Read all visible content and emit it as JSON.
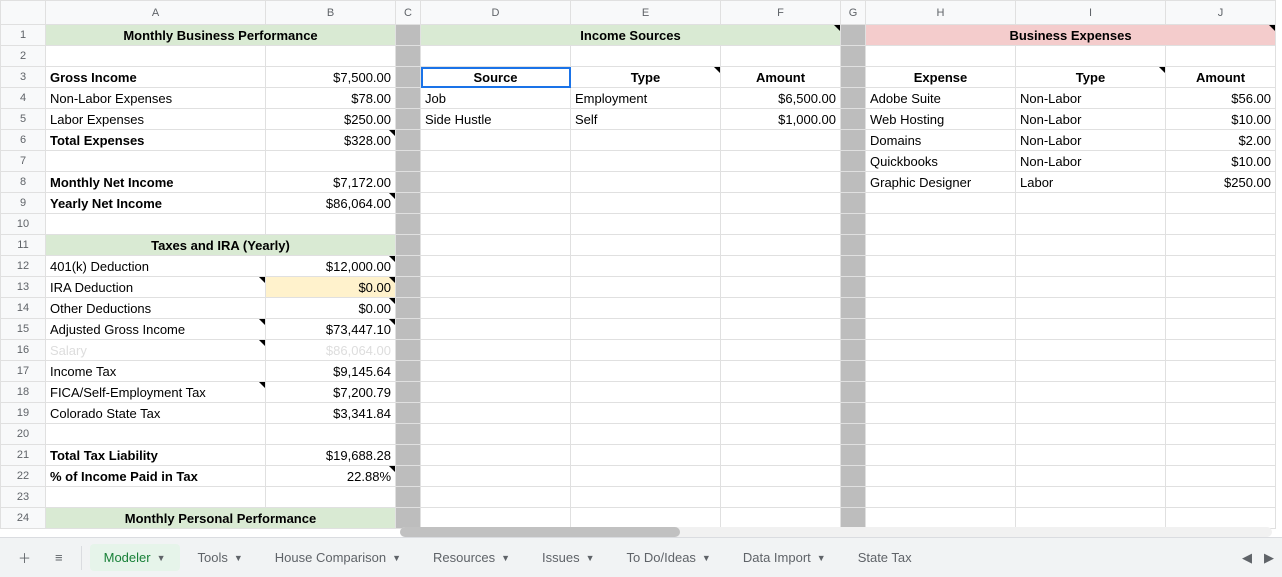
{
  "columns": [
    "A",
    "B",
    "C",
    "D",
    "E",
    "F",
    "G",
    "H",
    "I",
    "J"
  ],
  "sections": {
    "monthly_business": "Monthly Business Performance",
    "income_sources": "Income Sources",
    "business_expenses": "Business Expenses",
    "taxes_ira": "Taxes and IRA (Yearly)",
    "monthly_personal": "Monthly Personal Performance"
  },
  "labels": {
    "gross_income": "Gross Income",
    "non_labor_exp": "Non-Labor Expenses",
    "labor_exp": "Labor Expenses",
    "total_exp": "Total Expenses",
    "monthly_net": "Monthly Net Income",
    "yearly_net": "Yearly Net Income",
    "k401": "401(k) Deduction",
    "ira": "IRA Deduction",
    "other_ded": "Other Deductions",
    "agi": "Adjusted Gross Income",
    "salary": "Salary",
    "income_tax": "Income Tax",
    "fica": "FICA/Self-Employment Tax",
    "state_tax": "Colorado State Tax",
    "total_tax": "Total Tax Liability",
    "pct_tax": "% of Income Paid in Tax"
  },
  "values": {
    "gross_income": "$7,500.00",
    "non_labor_exp": "$78.00",
    "labor_exp": "$250.00",
    "total_exp": "$328.00",
    "monthly_net": "$7,172.00",
    "yearly_net": "$86,064.00",
    "k401": "$12,000.00",
    "ira": "$0.00",
    "other_ded": "$0.00",
    "agi": "$73,447.10",
    "salary": "$86,064.00",
    "income_tax": "$9,145.64",
    "fica": "$7,200.79",
    "state_tax": "$3,341.84",
    "total_tax": "$19,688.28",
    "pct_tax": "22.88%"
  },
  "income_headers": {
    "source": "Source",
    "type": "Type",
    "amount": "Amount"
  },
  "income_rows": [
    {
      "source": "Job",
      "type": "Employment",
      "amount": "$6,500.00"
    },
    {
      "source": "Side Hustle",
      "type": "Self",
      "amount": "$1,000.00"
    }
  ],
  "expense_headers": {
    "expense": "Expense",
    "type": "Type",
    "amount": "Amount"
  },
  "expense_rows": [
    {
      "expense": "Adobe Suite",
      "type": "Non-Labor",
      "amount": "$56.00"
    },
    {
      "expense": "Web Hosting",
      "type": "Non-Labor",
      "amount": "$10.00"
    },
    {
      "expense": "Domains",
      "type": "Non-Labor",
      "amount": "$2.00"
    },
    {
      "expense": "Quickbooks",
      "type": "Non-Labor",
      "amount": "$10.00"
    },
    {
      "expense": "Graphic Designer",
      "type": "Labor",
      "amount": "$250.00"
    }
  ],
  "tabs": {
    "active": "Modeler",
    "others": [
      "Tools",
      "House Comparison",
      "Resources",
      "Issues",
      "To Do/Ideas",
      "Data Import",
      "State Tax"
    ]
  }
}
